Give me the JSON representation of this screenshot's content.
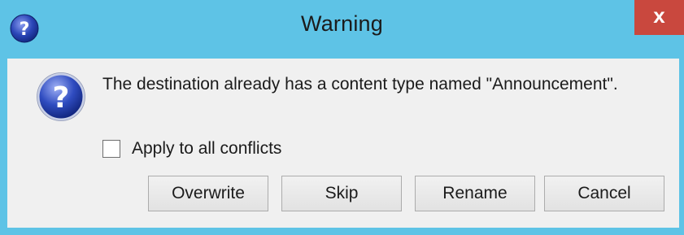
{
  "window": {
    "title": "Warning",
    "close_glyph": "x",
    "title_icon": "help-icon",
    "accent_color": "#5ec3e6",
    "close_color": "#c9483e"
  },
  "dialog": {
    "icon": "question-icon",
    "message": "The destination already has a content type named \"Announcement\".",
    "apply_all": {
      "label": "Apply to all conflicts",
      "checked": false
    },
    "buttons": {
      "overwrite": "Overwrite",
      "skip": "Skip",
      "rename": "Rename",
      "cancel": "Cancel"
    }
  }
}
